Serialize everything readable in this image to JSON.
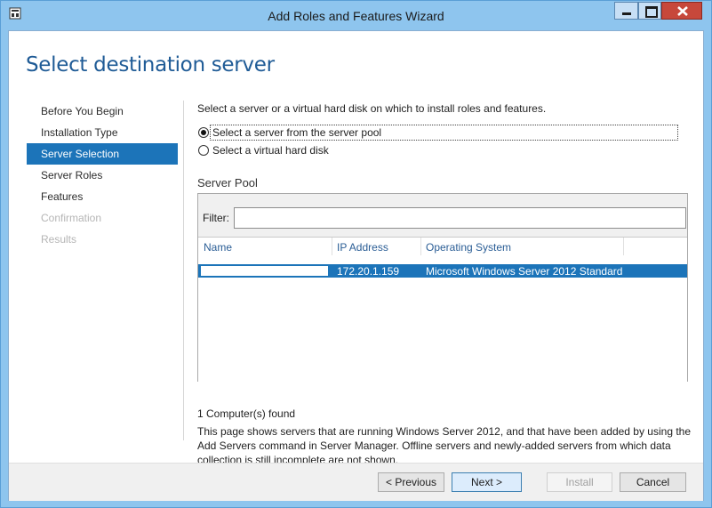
{
  "window": {
    "title": "Add Roles and Features Wizard"
  },
  "header": {
    "page_title": "Select destination server"
  },
  "nav": {
    "items": [
      {
        "label": "Before You Begin",
        "state": "normal"
      },
      {
        "label": "Installation Type",
        "state": "normal"
      },
      {
        "label": "Server Selection",
        "state": "active"
      },
      {
        "label": "Server Roles",
        "state": "normal"
      },
      {
        "label": "Features",
        "state": "normal"
      },
      {
        "label": "Confirmation",
        "state": "disabled"
      },
      {
        "label": "Results",
        "state": "disabled"
      }
    ]
  },
  "content": {
    "instruction": "Select a server or a virtual hard disk on which to install roles and features.",
    "options": [
      {
        "label": "Select a server from the server pool",
        "selected": true
      },
      {
        "label": "Select a virtual hard disk",
        "selected": false
      }
    ],
    "pool_title": "Server Pool",
    "filter_label": "Filter:",
    "filter_value": "",
    "columns": [
      "Name",
      "IP Address",
      "Operating System"
    ],
    "rows": [
      {
        "name": "",
        "ip": "172.20.1.159",
        "os": "Microsoft Windows Server 2012 Standard",
        "selected": true
      }
    ],
    "found": "1 Computer(s) found",
    "description": "This page shows servers that are running Windows Server 2012, and that have been added by using the Add Servers command in Server Manager. Offline servers and newly-added servers from which data collection is still incomplete are not shown."
  },
  "footer": {
    "previous": "< Previous",
    "next": "Next >",
    "install": "Install",
    "cancel": "Cancel"
  },
  "colors": {
    "accent": "#1c74b9",
    "title_text": "#1f5b96",
    "frame": "#8ec5ee",
    "close_button": "#c7483b"
  }
}
